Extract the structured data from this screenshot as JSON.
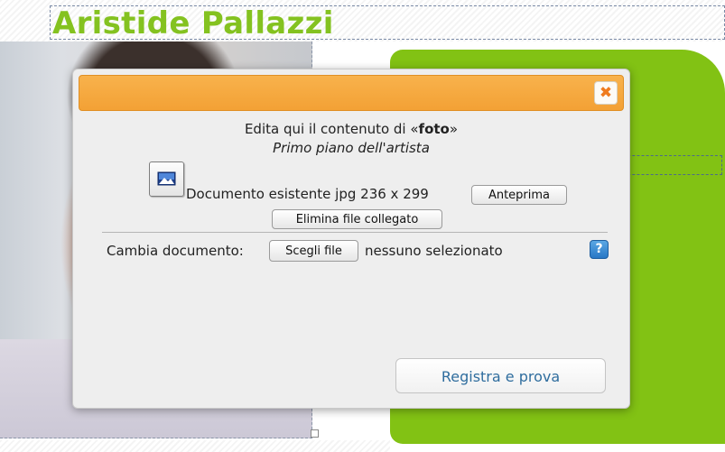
{
  "page": {
    "title": "Aristide Pallazzi"
  },
  "dialog": {
    "edit_prefix": "Edita qui il contenuto di «",
    "field_name": "foto",
    "edit_suffix": "»",
    "subtitle": "Primo piano dell'artista",
    "file_info": "Documento esistente jpg 236 x 299",
    "preview_label": "Anteprima",
    "delete_label": "Elimina file collegato",
    "change_label": "Cambia documento:",
    "choose_label": "Scegli file",
    "none_selected": "nessuno selezionato",
    "help_glyph": "?",
    "close_glyph": "✖",
    "save_label": "Registra e prova"
  },
  "colors": {
    "title_green": "#84c220",
    "panel_green": "#82c214",
    "header_orange": "#f3a135",
    "save_text_blue": "#2f6d9e"
  },
  "icons": {
    "close": "close-icon",
    "help": "help-icon",
    "image": "image-file-icon"
  }
}
